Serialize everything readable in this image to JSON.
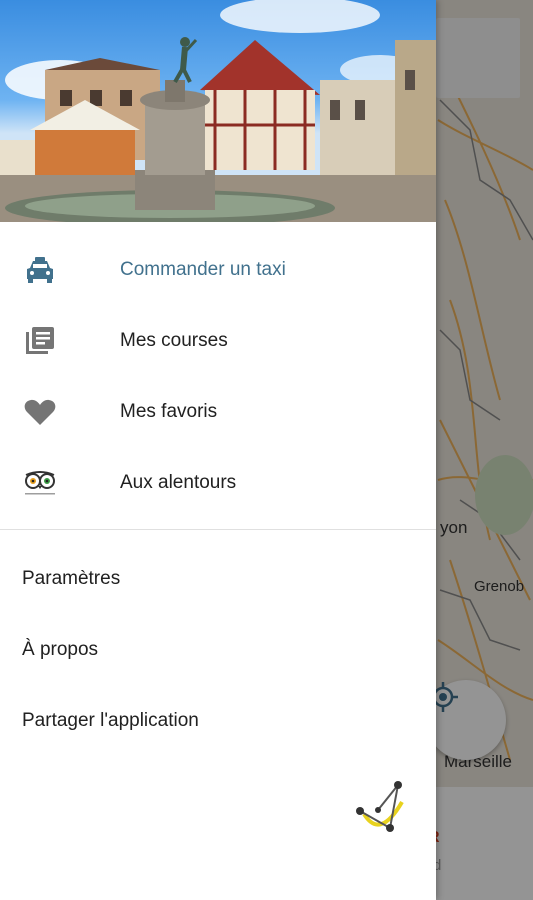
{
  "menu": {
    "primary": [
      {
        "label": "Commander un taxi",
        "icon": "taxi-icon",
        "active": true
      },
      {
        "label": "Mes courses",
        "icon": "rides-list-icon",
        "active": false
      },
      {
        "label": "Mes favoris",
        "icon": "heart-icon",
        "active": false
      },
      {
        "label": "Aux alentours",
        "icon": "tripadvisor-icon",
        "active": false
      }
    ],
    "secondary": [
      {
        "label": "Paramètres"
      },
      {
        "label": "À propos"
      },
      {
        "label": "Partager l'application"
      }
    ],
    "accent_color": "#41718d"
  },
  "map": {
    "cities": [
      "yon",
      "Grenob",
      "Marseille"
    ],
    "bottom_card": {
      "title": "R",
      "subtitle": "rd"
    }
  }
}
